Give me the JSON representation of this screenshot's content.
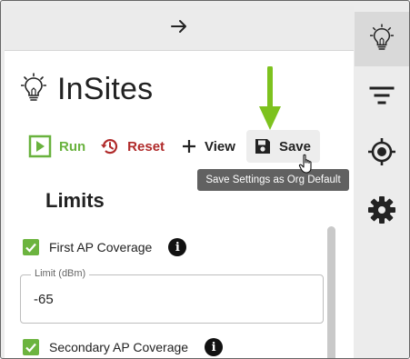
{
  "panel": {
    "title": "InSites",
    "toolbar": {
      "run_label": "Run",
      "reset_label": "Reset",
      "view_label": "View",
      "save_label": "Save"
    },
    "save_tooltip": "Save Settings as Org Default",
    "section_title": "Limits",
    "first_coverage": {
      "label": "First AP Coverage",
      "checked": true
    },
    "limit_field": {
      "label": "Limit (dBm)",
      "value": "-65"
    },
    "secondary_coverage": {
      "label": "Secondary AP Coverage",
      "checked": true
    }
  },
  "sidebar": {
    "items": [
      {
        "icon": "lightbulb-icon",
        "active": true
      },
      {
        "icon": "filter-icon",
        "active": false
      },
      {
        "icon": "target-icon",
        "active": false
      },
      {
        "icon": "gear-icon",
        "active": false
      }
    ]
  },
  "colors": {
    "accent_green": "#6cb43f",
    "run_green": "#69b23e",
    "reset_red": "#b02a2a",
    "annotation_arrow": "#7dc21e",
    "tooltip_bg": "#616161"
  }
}
